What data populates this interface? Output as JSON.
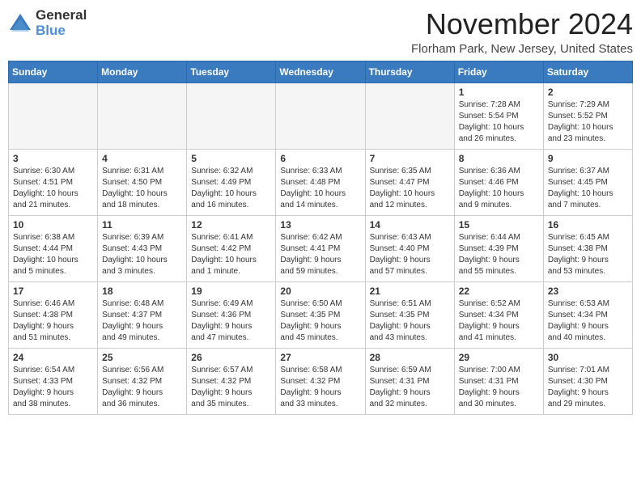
{
  "header": {
    "logo_general": "General",
    "logo_blue": "Blue",
    "month_title": "November 2024",
    "location": "Florham Park, New Jersey, United States"
  },
  "weekdays": [
    "Sunday",
    "Monday",
    "Tuesday",
    "Wednesday",
    "Thursday",
    "Friday",
    "Saturday"
  ],
  "weeks": [
    [
      {
        "day": "",
        "detail": ""
      },
      {
        "day": "",
        "detail": ""
      },
      {
        "day": "",
        "detail": ""
      },
      {
        "day": "",
        "detail": ""
      },
      {
        "day": "",
        "detail": ""
      },
      {
        "day": "1",
        "detail": "Sunrise: 7:28 AM\nSunset: 5:54 PM\nDaylight: 10 hours\nand 26 minutes."
      },
      {
        "day": "2",
        "detail": "Sunrise: 7:29 AM\nSunset: 5:52 PM\nDaylight: 10 hours\nand 23 minutes."
      }
    ],
    [
      {
        "day": "3",
        "detail": "Sunrise: 6:30 AM\nSunset: 4:51 PM\nDaylight: 10 hours\nand 21 minutes."
      },
      {
        "day": "4",
        "detail": "Sunrise: 6:31 AM\nSunset: 4:50 PM\nDaylight: 10 hours\nand 18 minutes."
      },
      {
        "day": "5",
        "detail": "Sunrise: 6:32 AM\nSunset: 4:49 PM\nDaylight: 10 hours\nand 16 minutes."
      },
      {
        "day": "6",
        "detail": "Sunrise: 6:33 AM\nSunset: 4:48 PM\nDaylight: 10 hours\nand 14 minutes."
      },
      {
        "day": "7",
        "detail": "Sunrise: 6:35 AM\nSunset: 4:47 PM\nDaylight: 10 hours\nand 12 minutes."
      },
      {
        "day": "8",
        "detail": "Sunrise: 6:36 AM\nSunset: 4:46 PM\nDaylight: 10 hours\nand 9 minutes."
      },
      {
        "day": "9",
        "detail": "Sunrise: 6:37 AM\nSunset: 4:45 PM\nDaylight: 10 hours\nand 7 minutes."
      }
    ],
    [
      {
        "day": "10",
        "detail": "Sunrise: 6:38 AM\nSunset: 4:44 PM\nDaylight: 10 hours\nand 5 minutes."
      },
      {
        "day": "11",
        "detail": "Sunrise: 6:39 AM\nSunset: 4:43 PM\nDaylight: 10 hours\nand 3 minutes."
      },
      {
        "day": "12",
        "detail": "Sunrise: 6:41 AM\nSunset: 4:42 PM\nDaylight: 10 hours\nand 1 minute."
      },
      {
        "day": "13",
        "detail": "Sunrise: 6:42 AM\nSunset: 4:41 PM\nDaylight: 9 hours\nand 59 minutes."
      },
      {
        "day": "14",
        "detail": "Sunrise: 6:43 AM\nSunset: 4:40 PM\nDaylight: 9 hours\nand 57 minutes."
      },
      {
        "day": "15",
        "detail": "Sunrise: 6:44 AM\nSunset: 4:39 PM\nDaylight: 9 hours\nand 55 minutes."
      },
      {
        "day": "16",
        "detail": "Sunrise: 6:45 AM\nSunset: 4:38 PM\nDaylight: 9 hours\nand 53 minutes."
      }
    ],
    [
      {
        "day": "17",
        "detail": "Sunrise: 6:46 AM\nSunset: 4:38 PM\nDaylight: 9 hours\nand 51 minutes."
      },
      {
        "day": "18",
        "detail": "Sunrise: 6:48 AM\nSunset: 4:37 PM\nDaylight: 9 hours\nand 49 minutes."
      },
      {
        "day": "19",
        "detail": "Sunrise: 6:49 AM\nSunset: 4:36 PM\nDaylight: 9 hours\nand 47 minutes."
      },
      {
        "day": "20",
        "detail": "Sunrise: 6:50 AM\nSunset: 4:35 PM\nDaylight: 9 hours\nand 45 minutes."
      },
      {
        "day": "21",
        "detail": "Sunrise: 6:51 AM\nSunset: 4:35 PM\nDaylight: 9 hours\nand 43 minutes."
      },
      {
        "day": "22",
        "detail": "Sunrise: 6:52 AM\nSunset: 4:34 PM\nDaylight: 9 hours\nand 41 minutes."
      },
      {
        "day": "23",
        "detail": "Sunrise: 6:53 AM\nSunset: 4:34 PM\nDaylight: 9 hours\nand 40 minutes."
      }
    ],
    [
      {
        "day": "24",
        "detail": "Sunrise: 6:54 AM\nSunset: 4:33 PM\nDaylight: 9 hours\nand 38 minutes."
      },
      {
        "day": "25",
        "detail": "Sunrise: 6:56 AM\nSunset: 4:32 PM\nDaylight: 9 hours\nand 36 minutes."
      },
      {
        "day": "26",
        "detail": "Sunrise: 6:57 AM\nSunset: 4:32 PM\nDaylight: 9 hours\nand 35 minutes."
      },
      {
        "day": "27",
        "detail": "Sunrise: 6:58 AM\nSunset: 4:32 PM\nDaylight: 9 hours\nand 33 minutes."
      },
      {
        "day": "28",
        "detail": "Sunrise: 6:59 AM\nSunset: 4:31 PM\nDaylight: 9 hours\nand 32 minutes."
      },
      {
        "day": "29",
        "detail": "Sunrise: 7:00 AM\nSunset: 4:31 PM\nDaylight: 9 hours\nand 30 minutes."
      },
      {
        "day": "30",
        "detail": "Sunrise: 7:01 AM\nSunset: 4:30 PM\nDaylight: 9 hours\nand 29 minutes."
      }
    ]
  ]
}
